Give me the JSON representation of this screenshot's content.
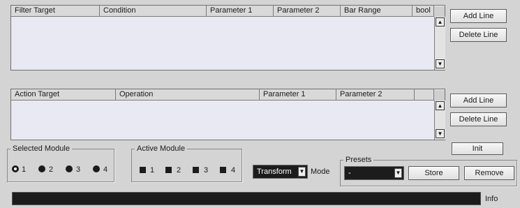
{
  "filter_table": {
    "columns": [
      "Filter Target",
      "Condition",
      "Parameter 1",
      "Parameter 2",
      "Bar Range",
      "bool"
    ],
    "add_label": "Add Line",
    "delete_label": "Delete Line"
  },
  "action_table": {
    "columns": [
      "Action Target",
      "Operation",
      "Parameter 1",
      "Parameter 2"
    ],
    "add_label": "Add Line",
    "delete_label": "Delete Line"
  },
  "init_label": "Init",
  "selected_module": {
    "title": "Selected Module",
    "options": [
      "1",
      "2",
      "3",
      "4"
    ],
    "selected": "1"
  },
  "active_module": {
    "title": "Active Module",
    "options": [
      "1",
      "2",
      "3",
      "4"
    ],
    "checked": [
      "1",
      "2",
      "3",
      "4"
    ]
  },
  "mode": {
    "value": "Transform",
    "label": "Mode"
  },
  "presets": {
    "title": "Presets",
    "value": "-",
    "store_label": "Store",
    "remove_label": "Remove"
  },
  "info": {
    "label": "Info",
    "text": ""
  },
  "scroll_up_glyph": "▲",
  "scroll_down_glyph": "▼",
  "dropdown_glyph": "▼"
}
